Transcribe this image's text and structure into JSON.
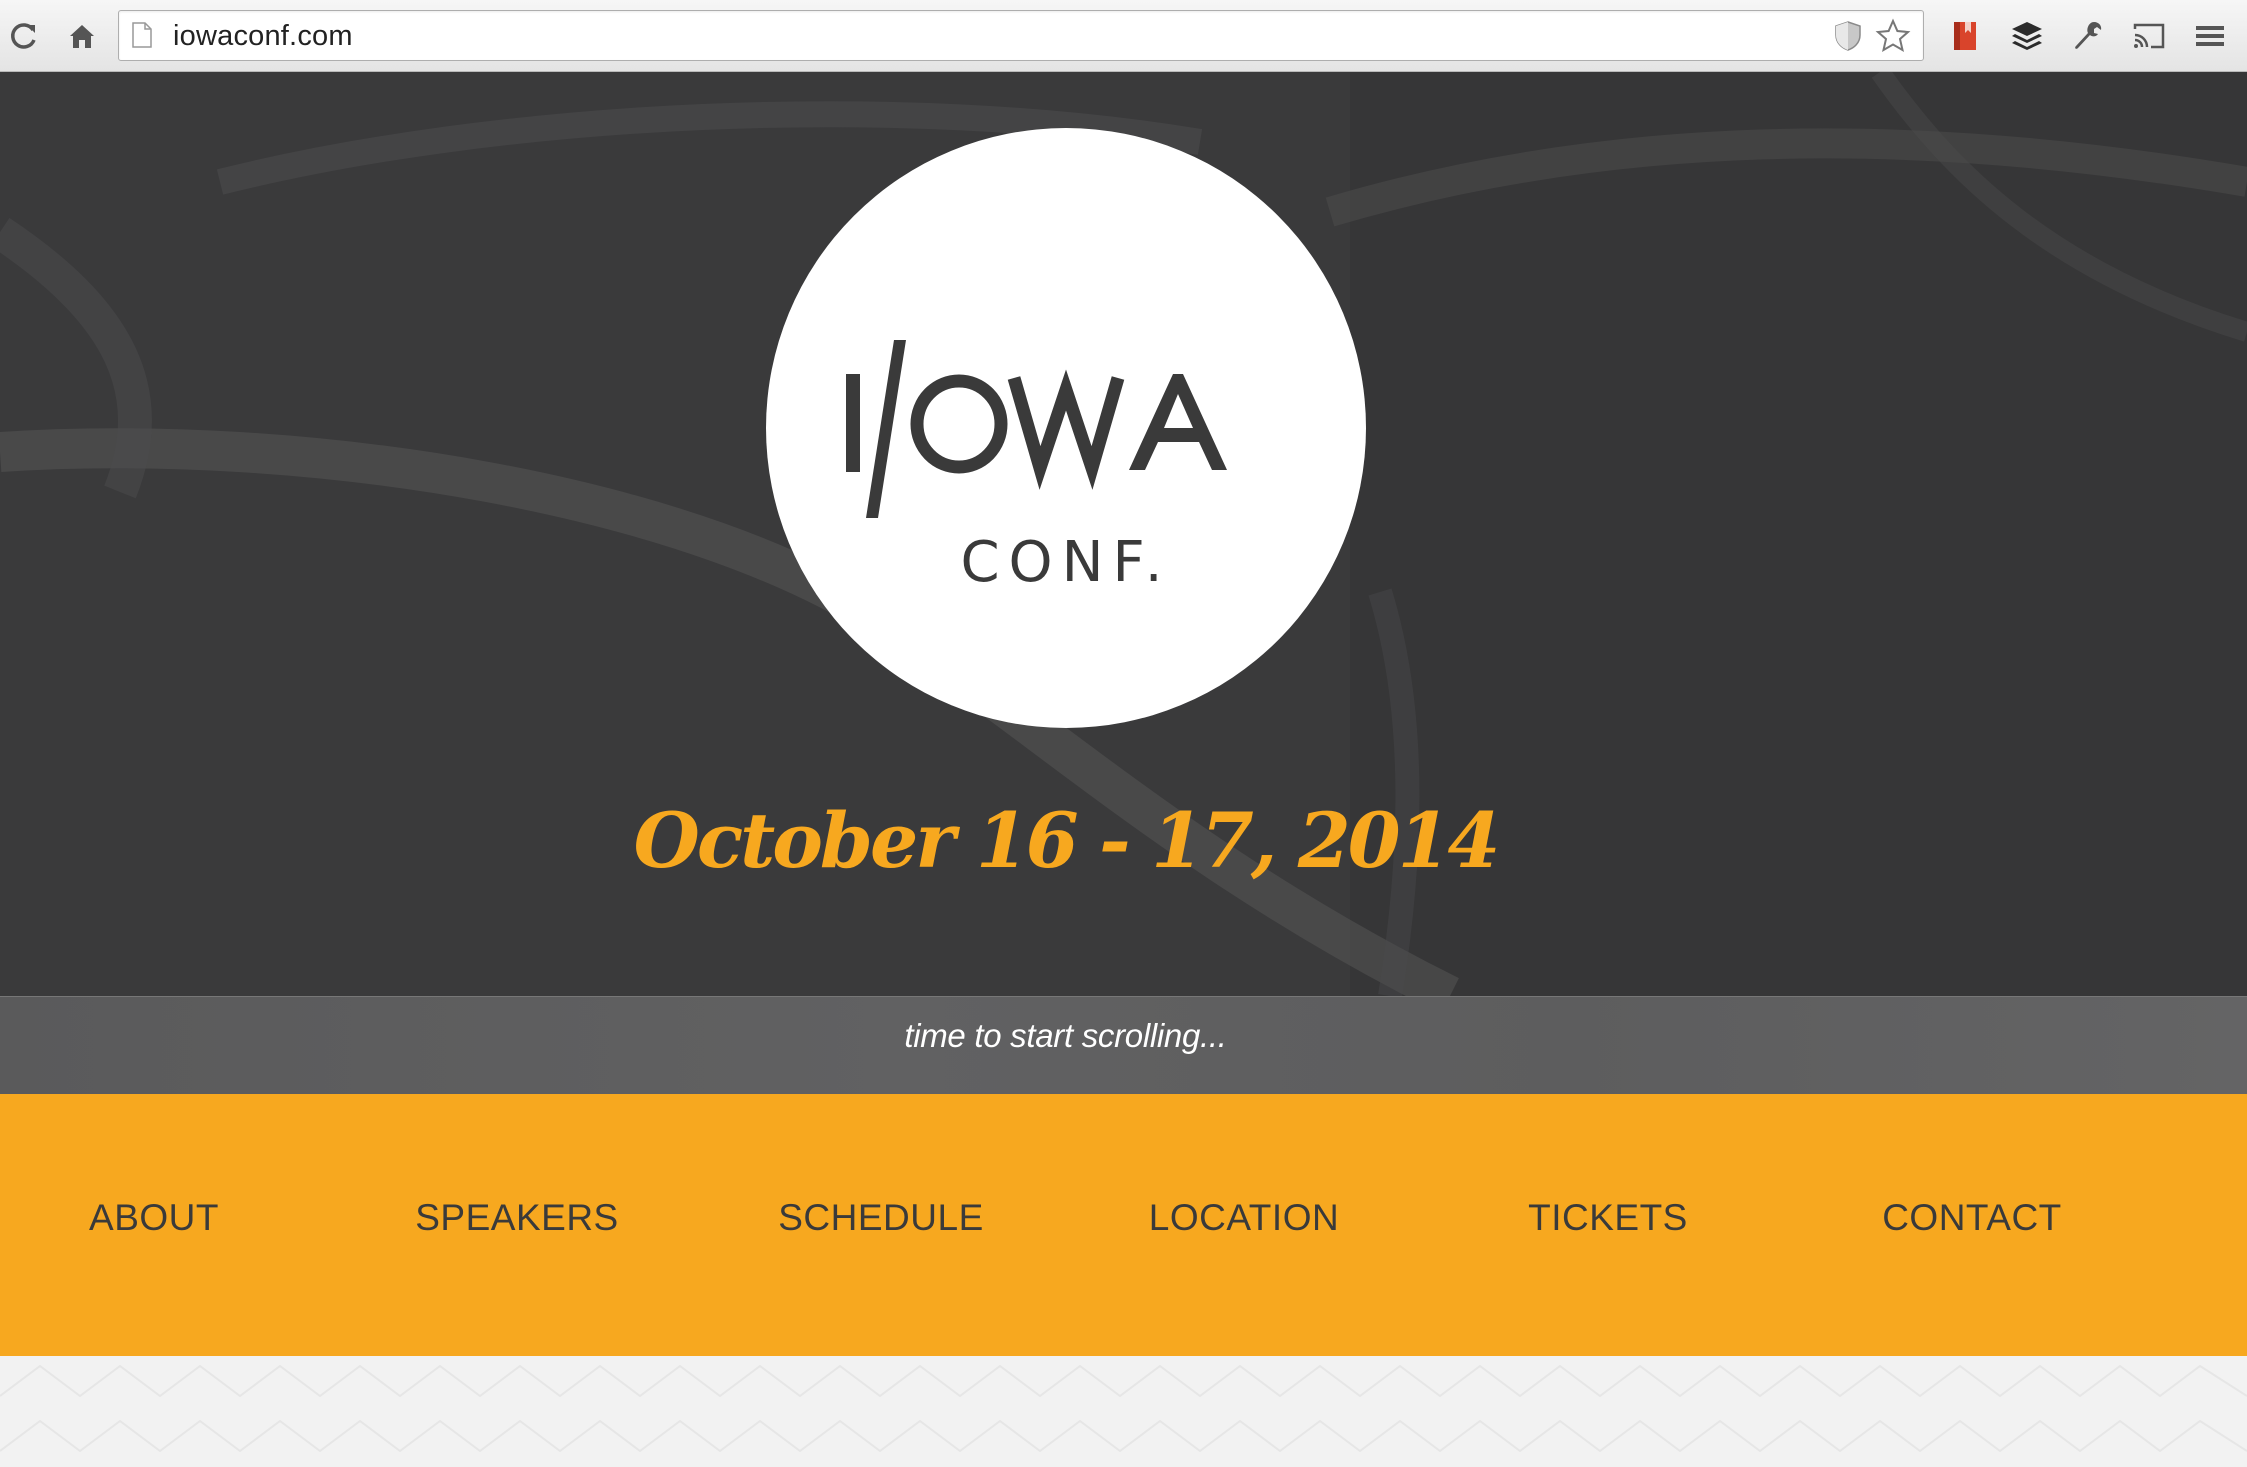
{
  "browser": {
    "url": "iowaconf.com",
    "icons": {
      "reload": "reload-icon",
      "home": "home-icon",
      "page": "page-icon",
      "shield": "shield-icon",
      "star": "star-icon",
      "bookmark": "bookmark-extension-icon",
      "buffer": "buffer-extension-icon",
      "wrench": "wrench-icon",
      "cast": "cast-icon",
      "menu": "hamburger-menu-icon"
    }
  },
  "hero": {
    "logo_main": "I/OWA",
    "logo_sub": "CONF.",
    "date": "October 16 - 17, 2014",
    "scroll_hint": "time to start scrolling..."
  },
  "nav": {
    "items": [
      {
        "label": "ABOUT"
      },
      {
        "label": "SPEAKERS"
      },
      {
        "label": "SCHEDULE"
      },
      {
        "label": "LOCATION"
      },
      {
        "label": "TICKETS"
      },
      {
        "label": "CONTACT"
      }
    ]
  },
  "colors": {
    "accent": "#f7a81f",
    "hero_bg": "#3b3b3c",
    "logo_text": "#3a3a3a",
    "page_bg": "#f2f2f2"
  }
}
